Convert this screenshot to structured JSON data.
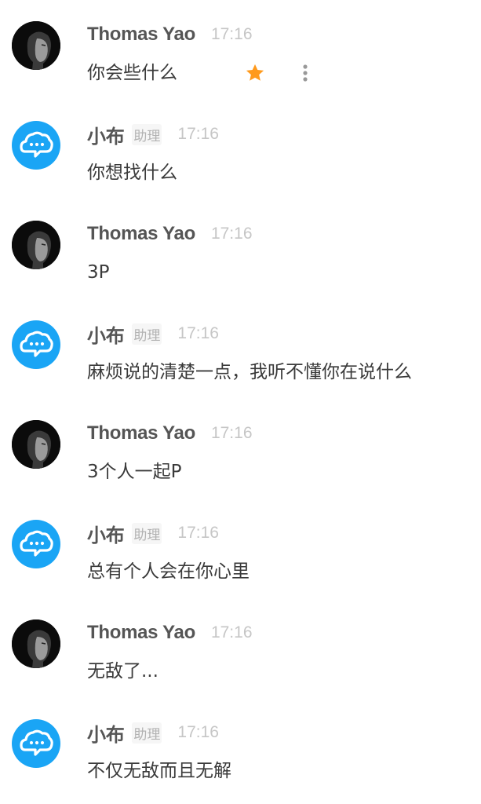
{
  "colors": {
    "user_avatar_bg": "#0b0b0b",
    "bot_avatar_bg": "#1aa5f5",
    "star": "#ff9a1c",
    "name": "#555555",
    "time": "#c6c6c6",
    "text": "#3a3a3a"
  },
  "messages": [
    {
      "sender": "Thomas Yao",
      "tag": "",
      "time": "17:16",
      "text": "你会些什么",
      "avatar_icon": "user-avatar"
    },
    {
      "sender": "小布",
      "tag": "助理",
      "time": "17:16",
      "text": "你想找什么",
      "avatar_icon": "cloud-chat-icon"
    },
    {
      "sender": "Thomas Yao",
      "tag": "",
      "time": "17:16",
      "text": "3P",
      "avatar_icon": "user-avatar"
    },
    {
      "sender": "小布",
      "tag": "助理",
      "time": "17:16",
      "text": "麻烦说的清楚一点，我听不懂你在说什么",
      "avatar_icon": "cloud-chat-icon"
    },
    {
      "sender": "Thomas Yao",
      "tag": "",
      "time": "17:16",
      "text": "3个人一起P",
      "avatar_icon": "user-avatar"
    },
    {
      "sender": "小布",
      "tag": "助理",
      "time": "17:16",
      "text": "总有个人会在你心里",
      "avatar_icon": "cloud-chat-icon"
    },
    {
      "sender": "Thomas Yao",
      "tag": "",
      "time": "17:16",
      "text": "无敌了...",
      "avatar_icon": "user-avatar"
    },
    {
      "sender": "小布",
      "tag": "助理",
      "time": "17:16",
      "text": "不仅无敌而且无解",
      "avatar_icon": "cloud-chat-icon"
    }
  ],
  "message_actions": {
    "star_icon": "star-icon",
    "more_icon": "more-vertical-icon"
  }
}
